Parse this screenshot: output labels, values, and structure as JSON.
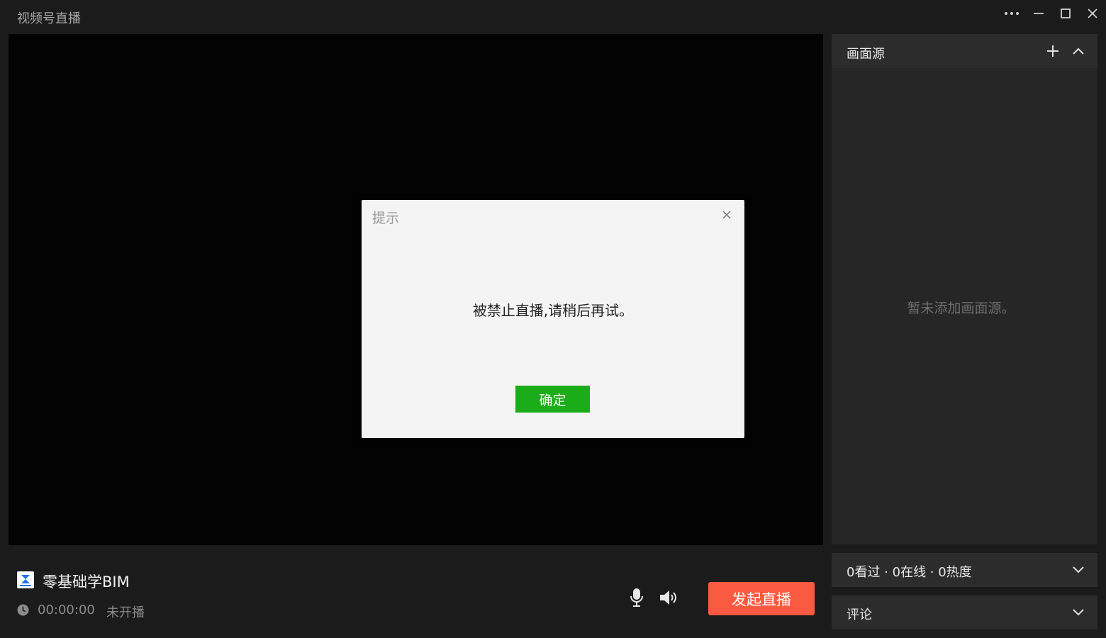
{
  "app": {
    "title": "视频号直播"
  },
  "window_controls": [
    {
      "name": "more",
      "icon": "more-icon"
    },
    {
      "name": "minimize",
      "icon": "minimize-icon"
    },
    {
      "name": "maximize",
      "icon": "maximize-icon"
    },
    {
      "name": "close",
      "icon": "close-icon"
    }
  ],
  "dialog": {
    "title": "提示",
    "message": "被禁止直播,请稍后再试。",
    "ok_label": "确定",
    "close_icon": "close-icon"
  },
  "sources": {
    "title": "画面源",
    "empty_text": "暂未添加画面源。",
    "add_icon": "plus-icon",
    "collapse_icon": "chevron-up-icon"
  },
  "stats": {
    "label": "0看过 · 0在线 · 0热度",
    "icon": "chevron-down-icon"
  },
  "comments": {
    "label": "评论",
    "icon": "chevron-down-icon"
  },
  "channel": {
    "name": "零基础学BIM",
    "logo_icon": "channel-logo-icon",
    "elapsed": "00:00:00",
    "status": "未开播"
  },
  "controls": {
    "mic_icon": "microphone-icon",
    "speaker_icon": "speaker-icon",
    "start_label": "发起直播"
  },
  "colors": {
    "accent_green": "#1aad19",
    "start_button": "#fa5a41",
    "background": "#1b1b1b",
    "panel": "#262626"
  }
}
